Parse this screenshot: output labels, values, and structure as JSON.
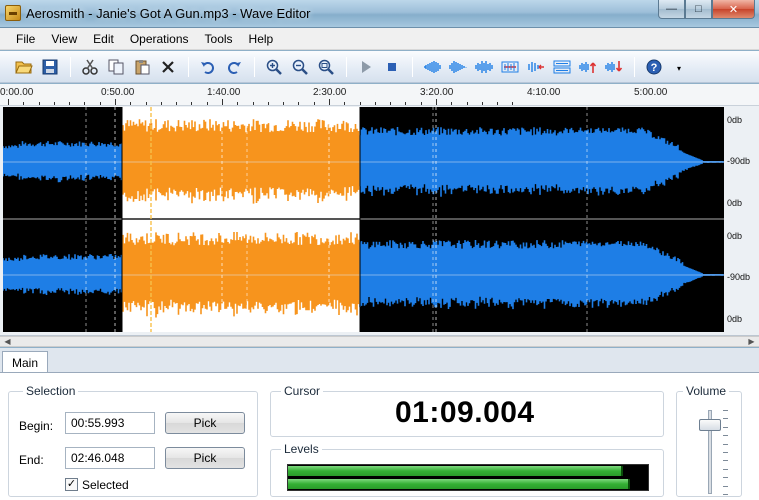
{
  "window": {
    "title": "Aerosmith - Janie's Got A Gun.mp3 - Wave Editor",
    "buttons": {
      "minimize": "—",
      "maximize": "□",
      "close": "✕"
    }
  },
  "menu": [
    "File",
    "View",
    "Edit",
    "Operations",
    "Tools",
    "Help"
  ],
  "toolbar": {
    "icons": [
      "open-folder-icon",
      "save-icon",
      "cut-icon",
      "copy-icon",
      "paste-icon",
      "delete-icon",
      "undo-icon",
      "redo-icon",
      "zoom-in-icon",
      "zoom-out-icon",
      "zoom-selection-icon",
      "play-icon",
      "stop-icon",
      "fade-in-icon",
      "fade-out-icon",
      "normalize-icon",
      "silence-icon",
      "reverse-icon",
      "swap-channels-icon",
      "volume-up-icon",
      "volume-down-icon",
      "help-icon"
    ]
  },
  "timeline": {
    "ticks": [
      "0:00.00",
      "0:50.00",
      "1:40.00",
      "2:30.00",
      "3:20.00",
      "4:10.00",
      "5:00.00"
    ]
  },
  "channels": {
    "db_labels": [
      "0db",
      "-90db",
      "0db",
      "0db",
      "-90db",
      "0db"
    ]
  },
  "colors": {
    "wave_blue": "#1e7ee6",
    "wave_selected": "#f7941d",
    "selection_bg": "#ffffff",
    "level_green": "#34b034"
  },
  "panel": {
    "tab": "Main",
    "selection": {
      "title": "Selection",
      "begin_label": "Begin:",
      "begin_value": "00:55.993",
      "end_label": "End:",
      "end_value": "02:46.048",
      "pick_label": "Pick",
      "selected_label": "Selected",
      "selected_checked": true
    },
    "cursor": {
      "title": "Cursor",
      "value": "01:09.004"
    },
    "levels": {
      "title": "Levels",
      "left": 0.93,
      "right": 0.95
    },
    "volume": {
      "title": "Volume",
      "level": 0.88
    }
  }
}
